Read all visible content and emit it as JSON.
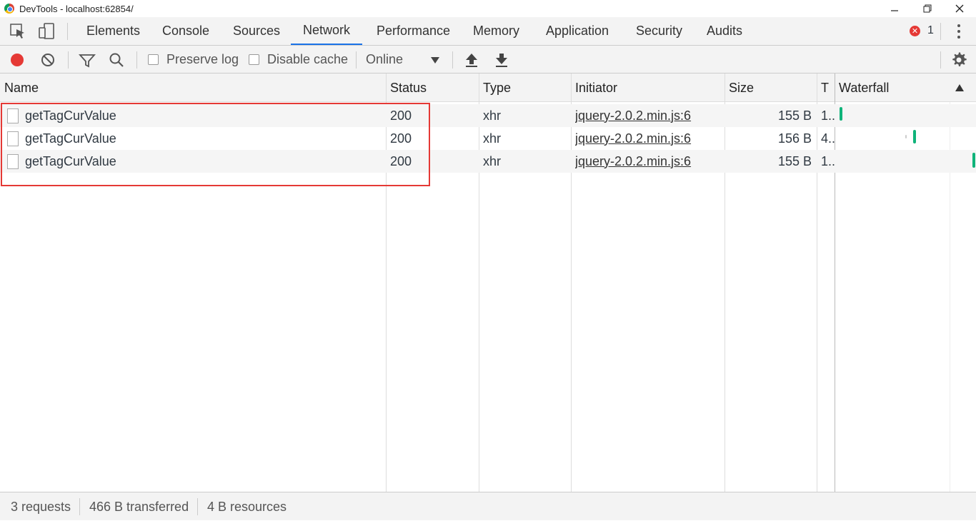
{
  "window": {
    "title": "DevTools - localhost:62854/"
  },
  "tabs": [
    "Elements",
    "Console",
    "Sources",
    "Network",
    "Performance",
    "Memory",
    "Application",
    "Security",
    "Audits"
  ],
  "active_tab": "Network",
  "errors": {
    "count": "1"
  },
  "toolbar": {
    "preserve_log": "Preserve log",
    "disable_cache": "Disable cache",
    "throttle": "Online"
  },
  "columns": {
    "name": "Name",
    "status": "Status",
    "type": "Type",
    "initiator": "Initiator",
    "size": "Size",
    "time": "T",
    "waterfall": "Waterfall"
  },
  "rows": [
    {
      "name": "getTagCurValue",
      "status": "200",
      "type": "xhr",
      "initiator": "jquery-2.0.2.min.js:6",
      "size": "155 B",
      "time": "1.."
    },
    {
      "name": "getTagCurValue",
      "status": "200",
      "type": "xhr",
      "initiator": "jquery-2.0.2.min.js:6",
      "size": "156 B",
      "time": "4.."
    },
    {
      "name": "getTagCurValue",
      "status": "200",
      "type": "xhr",
      "initiator": "jquery-2.0.2.min.js:6",
      "size": "155 B",
      "time": "1.."
    }
  ],
  "status_bar": {
    "requests": "3 requests",
    "transferred": "466 B transferred",
    "resources": "4 B resources"
  },
  "colors": {
    "record": "#e53935",
    "accent": "#1a73e8",
    "waterfall_bar": "#0fb37a",
    "highlight": "#e53935"
  }
}
